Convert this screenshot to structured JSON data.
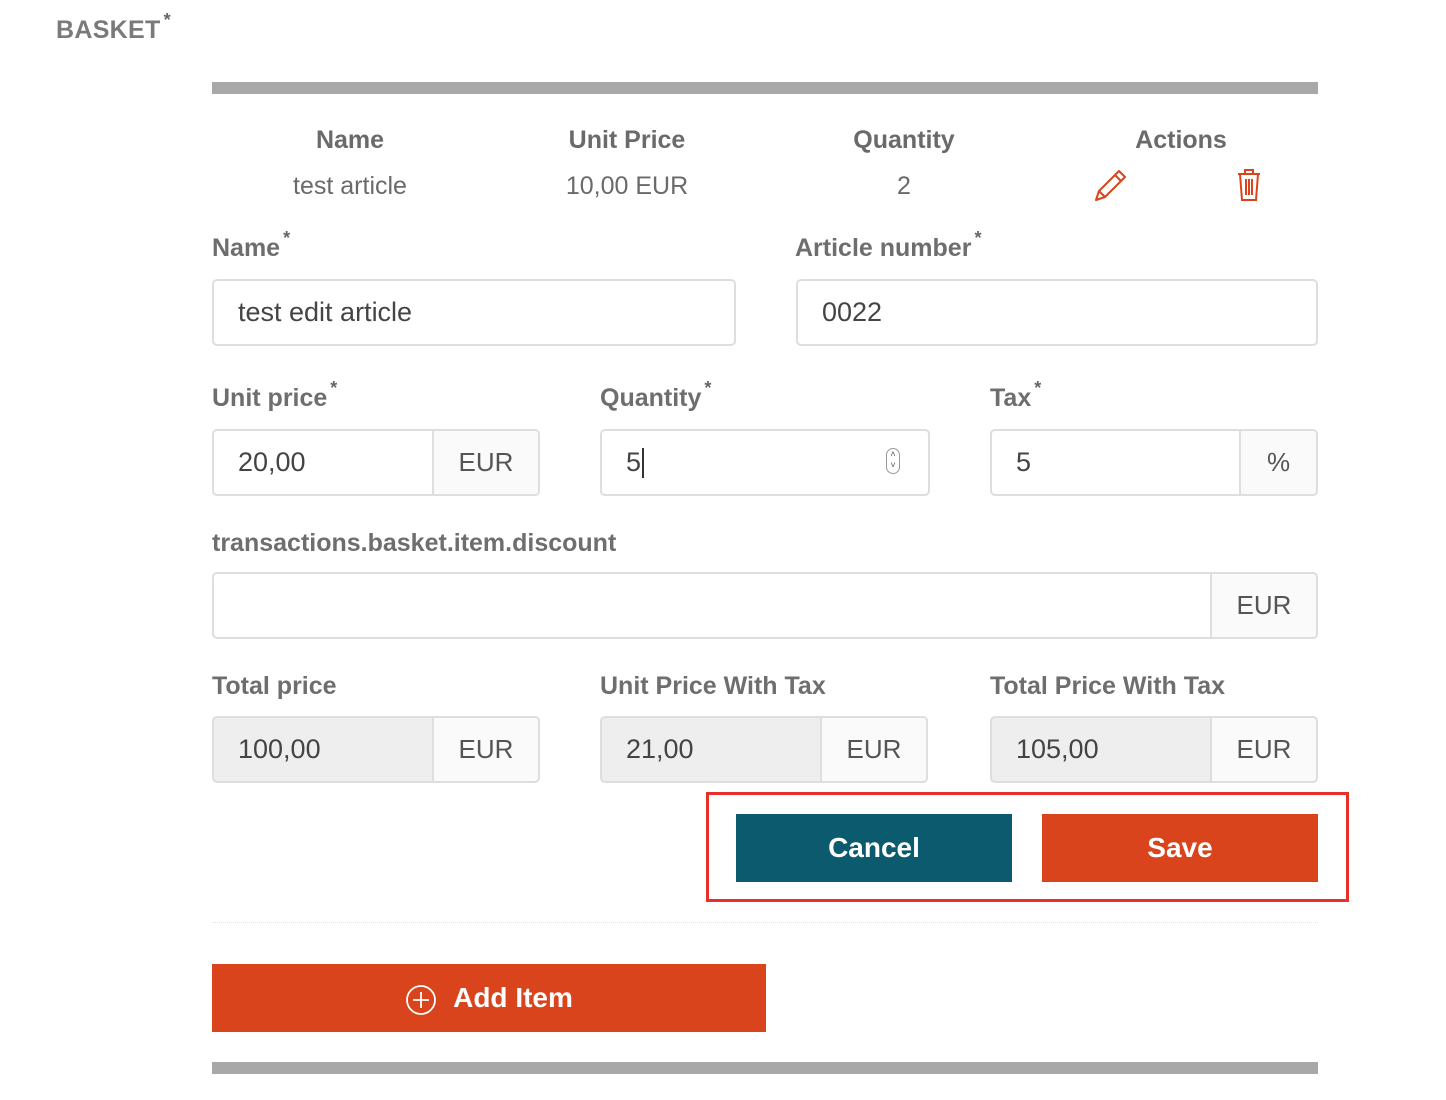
{
  "section": {
    "title": "BASKET",
    "required_mark": "*"
  },
  "table": {
    "headers": [
      "Name",
      "Unit Price",
      "Quantity",
      "Actions"
    ],
    "row": {
      "name": "test article",
      "unit_price": "10,00 EUR",
      "quantity": "2"
    },
    "icons": {
      "edit": "pencil-icon",
      "delete": "trash-icon"
    }
  },
  "form": {
    "name": {
      "label": "Name",
      "req": "*",
      "value": "test edit article"
    },
    "article_number": {
      "label": "Article number",
      "req": "*",
      "value": "0022"
    },
    "unit_price": {
      "label": "Unit price",
      "req": "*",
      "value": "20,00",
      "unit": "EUR"
    },
    "quantity": {
      "label": "Quantity",
      "req": "*",
      "value": "5"
    },
    "tax": {
      "label": "Tax",
      "req": "*",
      "value": "5",
      "unit": "%"
    },
    "discount": {
      "label": "transactions.basket.item.discount",
      "value": "",
      "unit": "EUR"
    },
    "total_price": {
      "label": "Total price",
      "value": "100,00",
      "unit": "EUR"
    },
    "unit_price_tax": {
      "label": "Unit Price With Tax",
      "value": "21,00",
      "unit": "EUR"
    },
    "total_price_tax": {
      "label": "Total Price With Tax",
      "value": "105,00",
      "unit": "EUR"
    }
  },
  "buttons": {
    "cancel": "Cancel",
    "save": "Save",
    "add_item": "Add Item"
  },
  "colors": {
    "primary_teal": "#0b5a6e",
    "accent_orange": "#d9441d",
    "highlight_red": "#e8302a",
    "icon_red": "#d9441d"
  }
}
